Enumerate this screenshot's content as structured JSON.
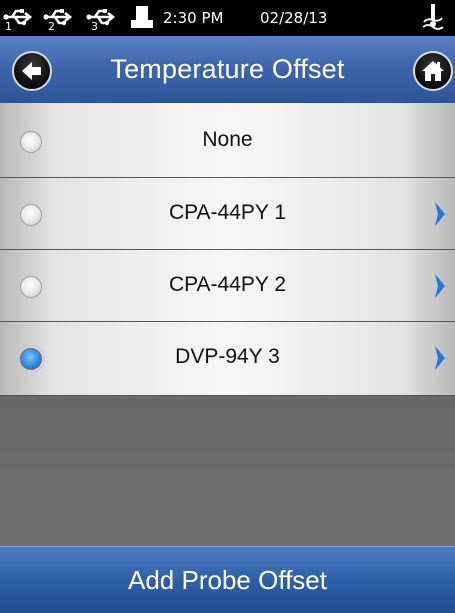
{
  "status_bar": {
    "usb_ports": [
      "1",
      "2",
      "3"
    ],
    "time": "2:30 PM",
    "date": "02/28/13",
    "icons": [
      "usb-icon",
      "printer-icon",
      "probe-icon"
    ]
  },
  "header": {
    "title": "Temperature Offset",
    "back_icon": "back-arrow-icon",
    "home_icon": "home-icon"
  },
  "options": [
    {
      "label": "None",
      "selected": false,
      "has_chevron": false
    },
    {
      "label": "CPA-44PY 1",
      "selected": false,
      "has_chevron": true
    },
    {
      "label": "CPA-44PY 2",
      "selected": false,
      "has_chevron": true
    },
    {
      "label": "DVP-94Y 3",
      "selected": true,
      "has_chevron": true
    }
  ],
  "footer": {
    "add_button_label": "Add Probe Offset"
  },
  "colors": {
    "header_blue": "#3d66ad",
    "selected_radio": "#2b8de0",
    "chevron_blue": "#1f7ad6"
  }
}
